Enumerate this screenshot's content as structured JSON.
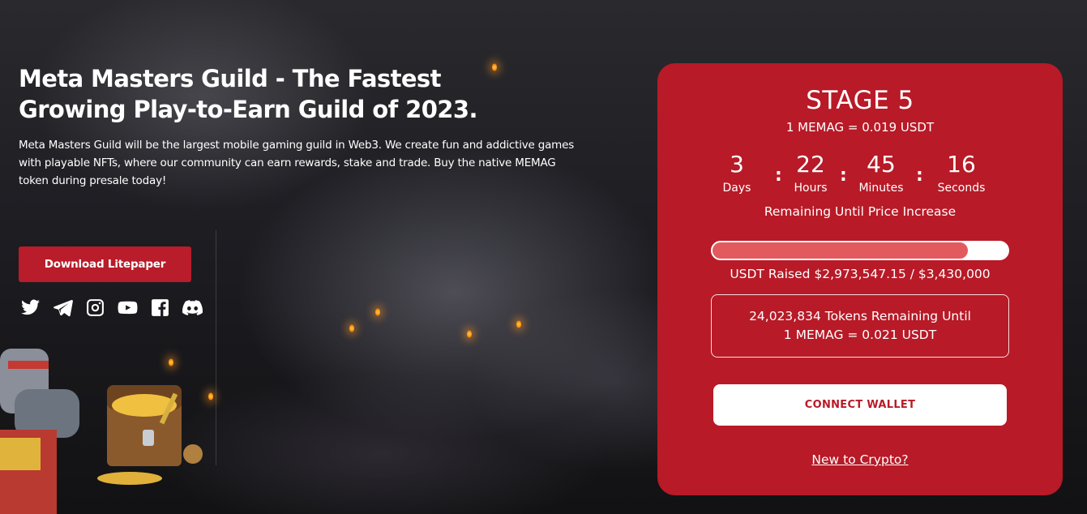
{
  "hero": {
    "title_line1": "Meta Masters Guild - The Fastest",
    "title_line2": "Growing Play-to-Earn Guild of 2023.",
    "description": "Meta Masters Guild will be the largest mobile gaming guild in Web3. We create fun and addictive games with playable NFTs, where our community can earn rewards, stake and trade. Buy the native MEMAG token during presale today!",
    "download_label": "Download Litepaper"
  },
  "socials": [
    "twitter-icon",
    "telegram-icon",
    "instagram-icon",
    "youtube-icon",
    "facebook-icon",
    "discord-icon"
  ],
  "presale": {
    "stage": "STAGE 5",
    "price": "1 MEMAG = 0.019 USDT",
    "countdown": {
      "days": "3",
      "days_label": "Days",
      "hours": "22",
      "hours_label": "Hours",
      "minutes": "45",
      "minutes_label": "Minutes",
      "seconds": "16",
      "seconds_label": "Seconds",
      "separator": ":"
    },
    "remaining_text": "Remaining Until Price Increase",
    "progress": 0.867,
    "raised_text": "USDT Raised $2,973,547.15 / $3,430,000",
    "tokens_line1": "24,023,834 Tokens Remaining Until",
    "tokens_line2": "1 MEMAG = 0.021 USDT",
    "connect_label": "CONNECT WALLET",
    "new_to_crypto": "New to Crypto?"
  },
  "colors": {
    "card": "#b81a27",
    "button": "#b91c2a",
    "progress_fill": "#e35a5e"
  }
}
